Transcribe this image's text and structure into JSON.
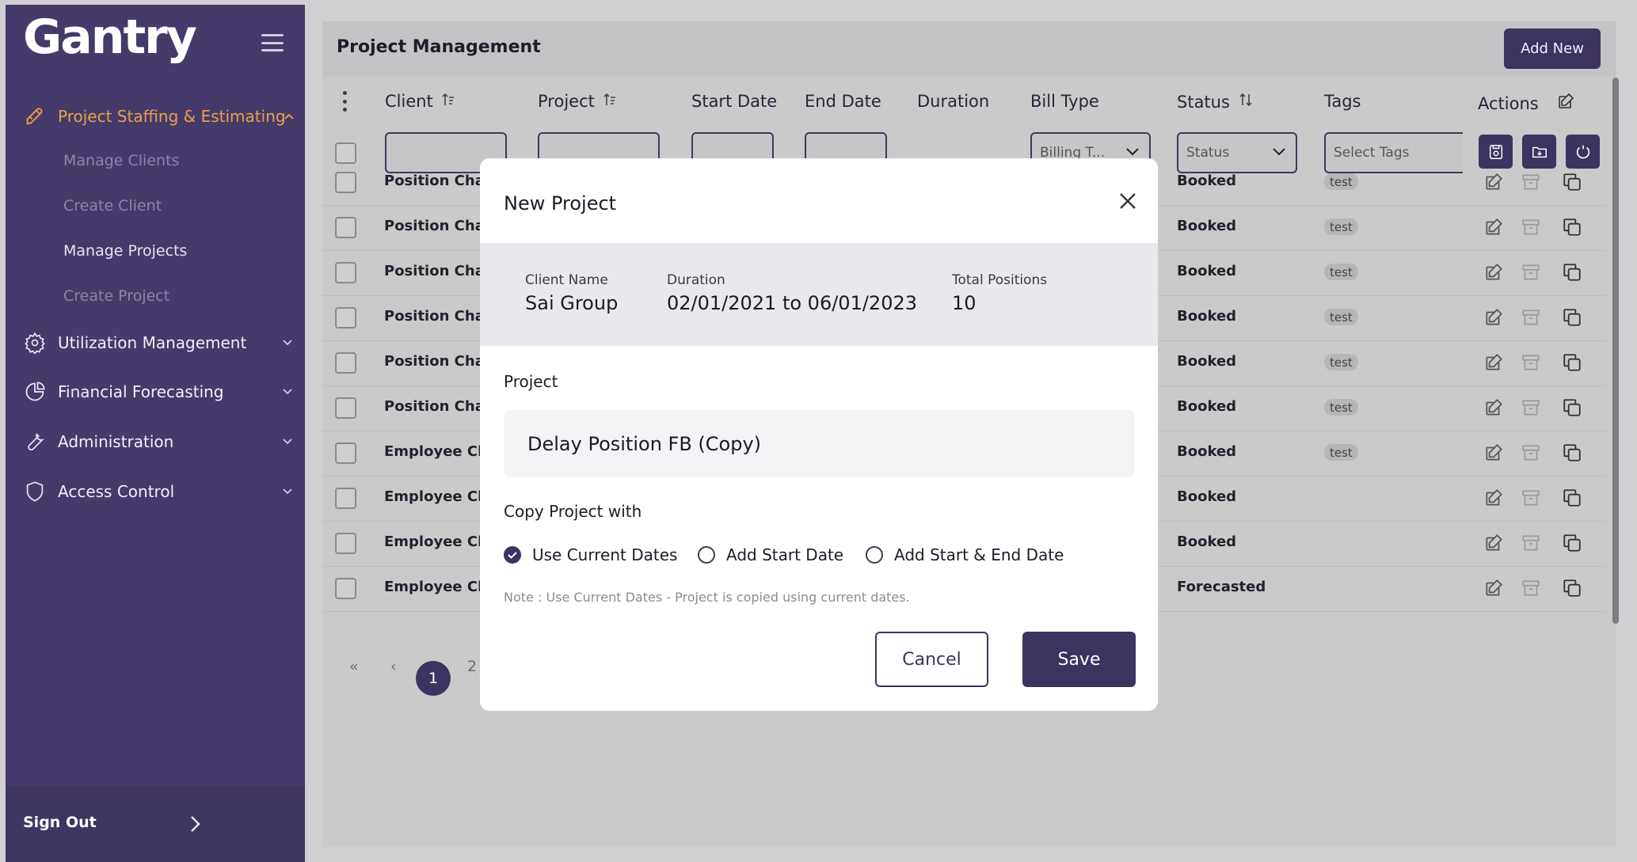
{
  "sidebar": {
    "logo": "Gantry",
    "nav": [
      {
        "label": "Project Staffing & Estimating",
        "icon": "rocket-icon"
      },
      {
        "label": "Utilization Management",
        "icon": "gear-icon"
      },
      {
        "label": "Financial Forecasting",
        "icon": "pie-chart-icon"
      },
      {
        "label": "Administration",
        "icon": "wrench-icon"
      },
      {
        "label": "Access Control",
        "icon": "shield-icon"
      }
    ],
    "sub_items": [
      "Manage Clients",
      "Create Client",
      "Manage Projects",
      "Create Project"
    ],
    "sign_out": "Sign Out"
  },
  "main": {
    "title": "Project Management",
    "add_new": "Add New",
    "columns": [
      "Client",
      "Project",
      "Start Date",
      "End Date",
      "Duration",
      "Bill Type",
      "Status",
      "Tags",
      "Actions"
    ],
    "filters": {
      "bill_type": "Billing T...",
      "status": "Status",
      "tags_placeholder": "Select Tags"
    },
    "rows": [
      {
        "client": "Position Chan",
        "status": "Booked",
        "tag": "test"
      },
      {
        "client": "Position Chan",
        "status": "Booked",
        "tag": "test"
      },
      {
        "client": "Position Chan",
        "status": "Booked",
        "tag": "test"
      },
      {
        "client": "Position Chan",
        "status": "Booked",
        "tag": "test"
      },
      {
        "client": "Position Chan",
        "status": "Booked",
        "tag": "test"
      },
      {
        "client": "Position Chan",
        "status": "Booked",
        "tag": "test"
      },
      {
        "client": "Employee Cha",
        "status": "Booked",
        "tag": "test"
      },
      {
        "client": "Employee Cha",
        "status": "Booked",
        "tag": ""
      },
      {
        "client": "Employee Cha",
        "status": "Booked",
        "tag": ""
      },
      {
        "client": "Employee Cha",
        "status": "Forecasted",
        "tag": ""
      }
    ],
    "pagination": {
      "first": "«",
      "prev": "‹",
      "current": "1",
      "next_page": "2"
    }
  },
  "modal": {
    "title": "New  Project",
    "client_name_label": "Client Name",
    "client_name": "Sai Group",
    "duration_label": "Duration",
    "duration": "02/01/2021 to 06/01/2023",
    "total_positions_label": "Total Positions",
    "total_positions": "10",
    "project_label": "Project",
    "project_value": "Delay Position FB (Copy)",
    "copy_with_label": "Copy Project with",
    "options": [
      "Use Current Dates",
      "Add Start Date",
      "Add Start & End Date"
    ],
    "selected_option": "Use Current Dates",
    "note": "Note : Use Current Dates - Project is copied using current dates.",
    "cancel": "Cancel",
    "save": "Save"
  },
  "colors": {
    "brand_purple": "#453a69",
    "accent_orange": "#e8a04a",
    "button_dark": "#3d3360"
  }
}
